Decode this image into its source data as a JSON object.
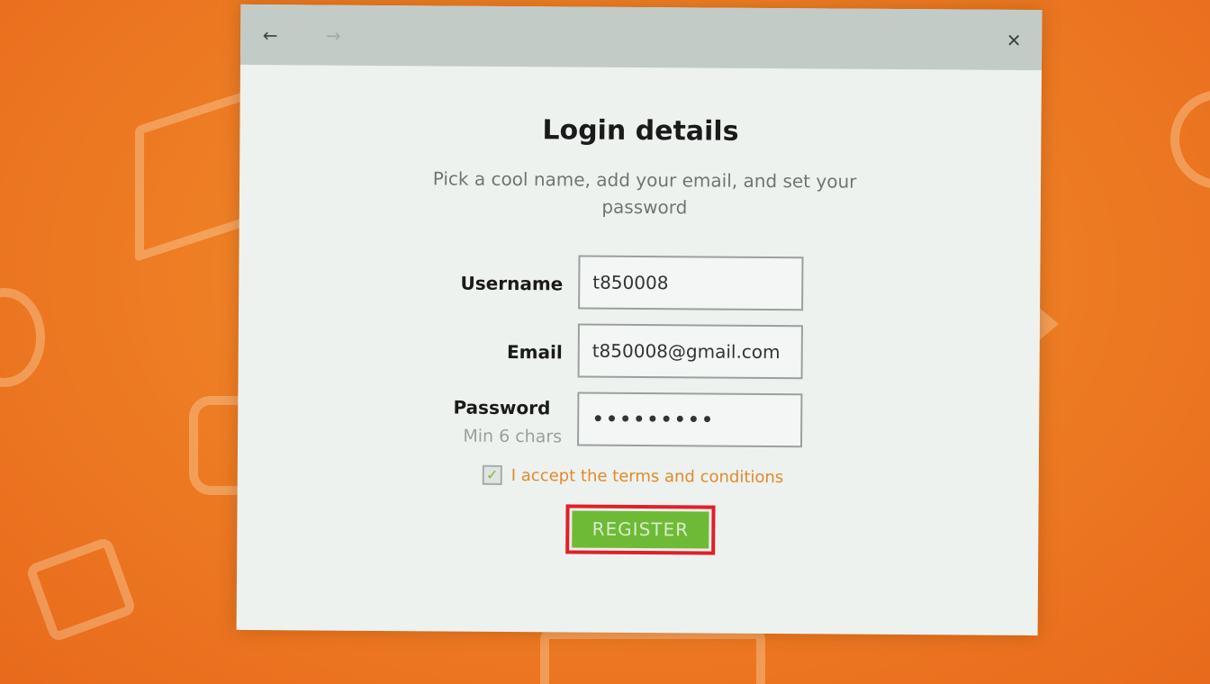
{
  "dialog": {
    "nav": {
      "back_icon": "arrow-left-icon",
      "back_glyph": "←",
      "forward_icon": "arrow-right-icon",
      "forward_glyph": "→",
      "close_icon": "close-icon",
      "close_glyph": "✕"
    },
    "heading": "Login details",
    "subheading": "Pick a cool name, add your email, and set your password",
    "form": {
      "username": {
        "label": "Username",
        "value": "t850008"
      },
      "email": {
        "label": "Email",
        "value": "t850008@gmail.com"
      },
      "password": {
        "label": "Password",
        "hint": "Min 6 chars",
        "value": "•••••••••"
      }
    },
    "terms": {
      "checked": true,
      "check_glyph": "✓",
      "label": "I accept the terms and conditions"
    },
    "register_button": "REGISTER"
  },
  "colors": {
    "background": "#ee7f25",
    "accent_green": "#6eba36",
    "highlight_red": "#e0202a",
    "terms_orange": "#e08a2c"
  }
}
